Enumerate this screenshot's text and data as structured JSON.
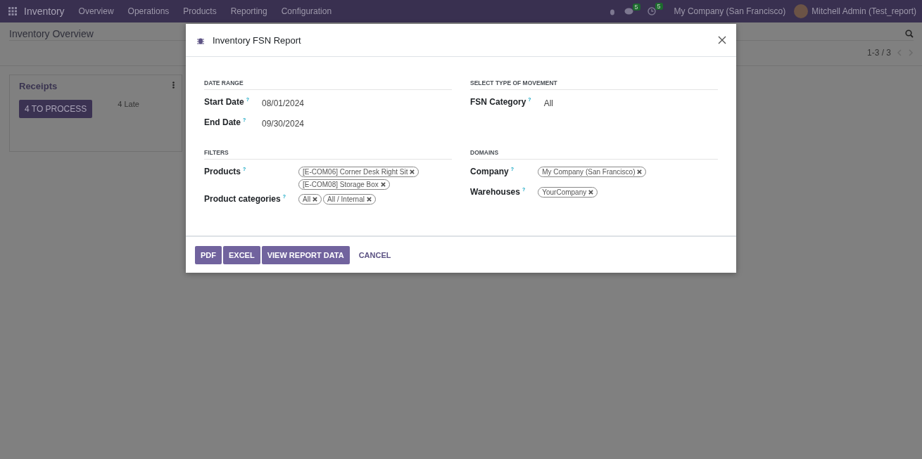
{
  "navbar": {
    "app": "Inventory",
    "menu": [
      "Overview",
      "Operations",
      "Products",
      "Reporting",
      "Configuration"
    ],
    "messages_count": "5",
    "activities_count": "5",
    "company": "My Company (San Francisco)",
    "user": "Mitchell Admin (Test_report)"
  },
  "control_panel": {
    "title": "Inventory Overview",
    "pager": "1-3 / 3"
  },
  "cards": [
    {
      "title": "Receipts",
      "button": "4 TO PROCESS",
      "late": "4 Late"
    }
  ],
  "dialog": {
    "title": "Inventory FSN Report",
    "sections": [
      {
        "heading": "DATE RANGE",
        "fields": [
          {
            "label": "Start Date",
            "help": "?",
            "kind": "text",
            "value": "08/01/2024"
          },
          {
            "label": "End Date",
            "help": "?",
            "kind": "text",
            "value": "09/30/2024"
          }
        ]
      },
      {
        "heading": "SELECT TYPE OF MOVEMENT",
        "fields": [
          {
            "label": "FSN Category",
            "help": "?",
            "kind": "text",
            "value": "All"
          }
        ]
      },
      {
        "heading": "FILTERS",
        "fields": [
          {
            "label": "Products",
            "help": "?",
            "kind": "tags",
            "tags": [
              "[E-COM06] Corner Desk Right Sit",
              "[E-COM08] Storage Box"
            ]
          },
          {
            "label": "Product categories",
            "help": "?",
            "kind": "tags",
            "tags": [
              "All",
              "All / Internal"
            ]
          }
        ]
      },
      {
        "heading": "DOMAINS",
        "fields": [
          {
            "label": "Company",
            "help": "?",
            "kind": "tags",
            "tags": [
              "My Company (San Francisco)"
            ]
          },
          {
            "label": "Warehouses",
            "help": "?",
            "kind": "tags",
            "tags": [
              "YourCompany"
            ]
          }
        ]
      }
    ],
    "buttons": [
      {
        "label": "PDF",
        "kind": "primary"
      },
      {
        "label": "EXCEL",
        "kind": "primary"
      },
      {
        "label": "VIEW REPORT DATA",
        "kind": "primary"
      },
      {
        "label": "CANCEL",
        "kind": "link"
      }
    ]
  }
}
